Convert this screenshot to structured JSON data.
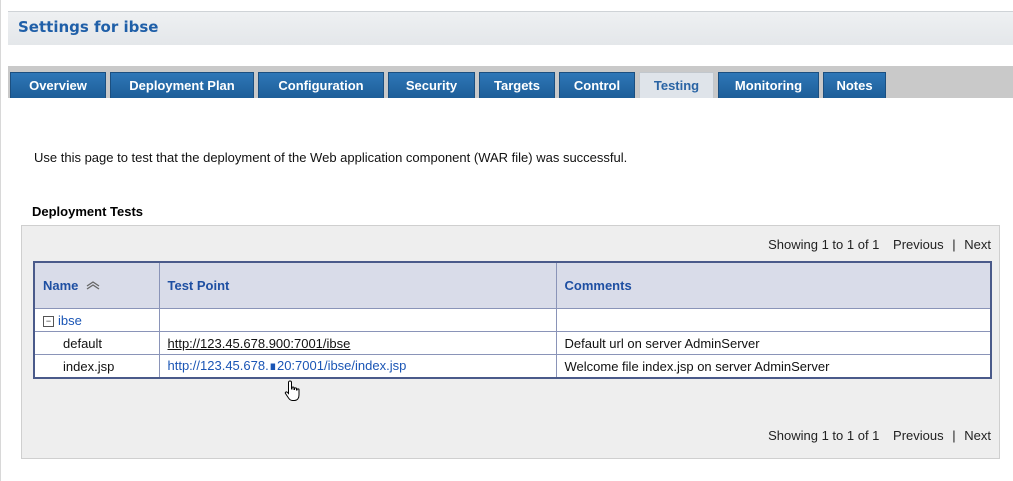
{
  "header": {
    "title": "Settings for ibse"
  },
  "tabs": [
    {
      "label": "Overview",
      "active": false
    },
    {
      "label": "Deployment Plan",
      "active": false
    },
    {
      "label": "Configuration",
      "active": false
    },
    {
      "label": "Security",
      "active": false
    },
    {
      "label": "Targets",
      "active": false
    },
    {
      "label": "Control",
      "active": false
    },
    {
      "label": "Testing",
      "active": true
    },
    {
      "label": "Monitoring",
      "active": false
    },
    {
      "label": "Notes",
      "active": false
    }
  ],
  "description": "Use this page to test that the deployment of the Web application component (WAR file) was successful.",
  "section_title": "Deployment Tests",
  "pager": {
    "showing": "Showing 1 to 1 of 1",
    "previous": "Previous",
    "separator": "|",
    "next": "Next"
  },
  "table": {
    "columns": {
      "name": "Name",
      "test_point": "Test Point",
      "comments": "Comments"
    },
    "group": {
      "toggle": "⊟",
      "name": "ibse"
    },
    "rows": [
      {
        "name": "default",
        "test_point": "http://123.45.678.900:7001/ibse",
        "comments": "Default url on server AdminServer"
      },
      {
        "name": "index.jsp",
        "test_point": "http://123.45.678.∎20:7001/ibse/index.jsp",
        "comments": "Welcome file index.jsp on server AdminServer"
      }
    ]
  },
  "colors": {
    "tab": "#2e77b7",
    "active_tab": "#dfe4ea",
    "link": "#1a55b5",
    "header_text": "#1f5fa8"
  }
}
